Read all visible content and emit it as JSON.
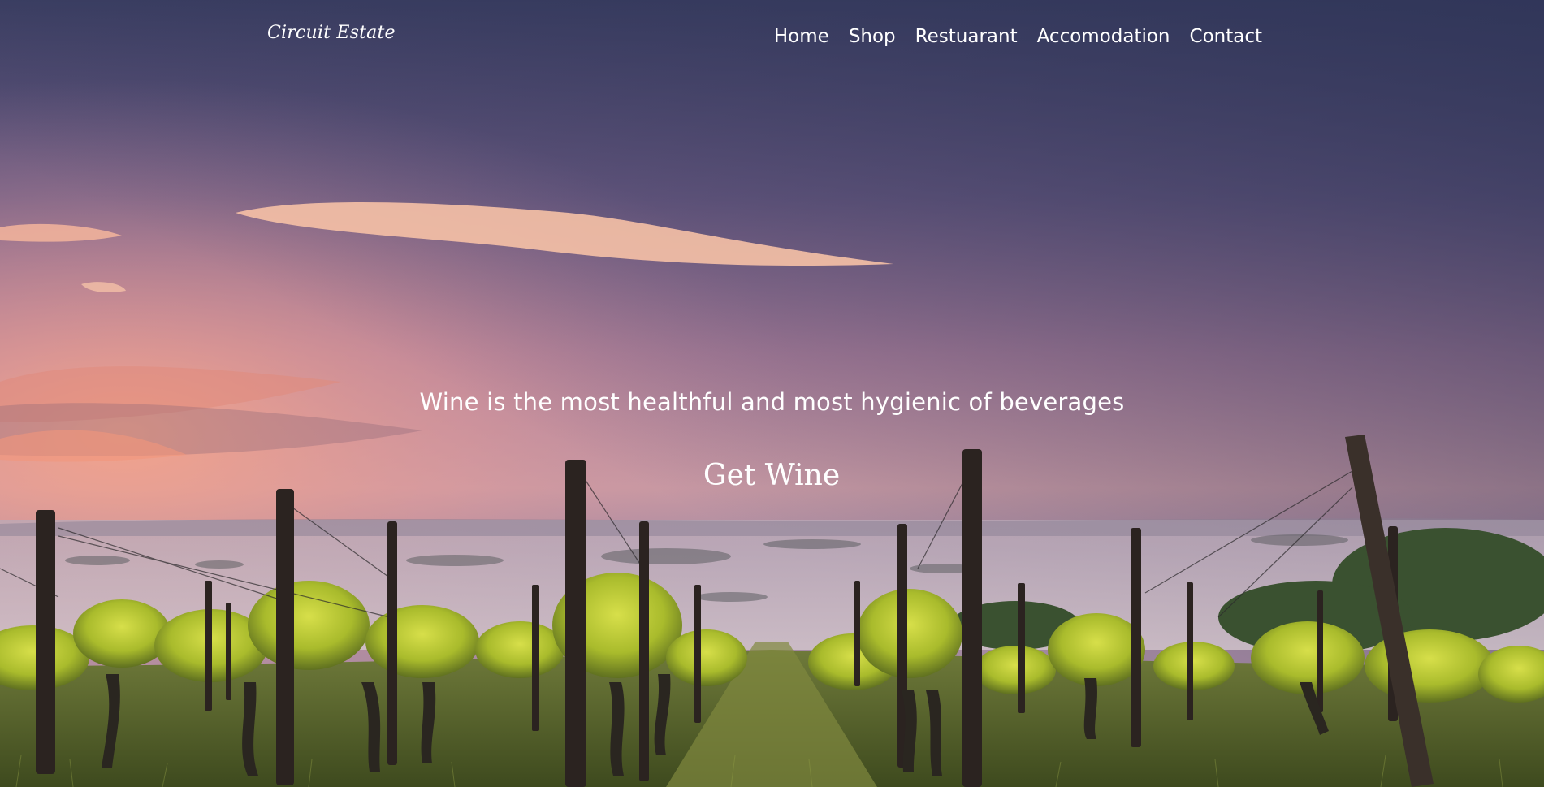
{
  "header": {
    "logo": "Circuit Estate"
  },
  "nav": {
    "items": [
      {
        "label": "Home"
      },
      {
        "label": "Shop"
      },
      {
        "label": "Restuarant"
      },
      {
        "label": "Accomodation"
      },
      {
        "label": "Contact"
      }
    ]
  },
  "hero": {
    "tagline": "Wine is the most healthful and most hygienic of beverages",
    "cta_label": "Get Wine",
    "image": "vineyard-sunrise-image"
  },
  "colors": {
    "text": "#ffffff",
    "sky_top": "#3a3d62",
    "sky_mid": "#8a6a8f",
    "sky_glow": "#f3a88f",
    "foliage": "#b7c83a"
  }
}
